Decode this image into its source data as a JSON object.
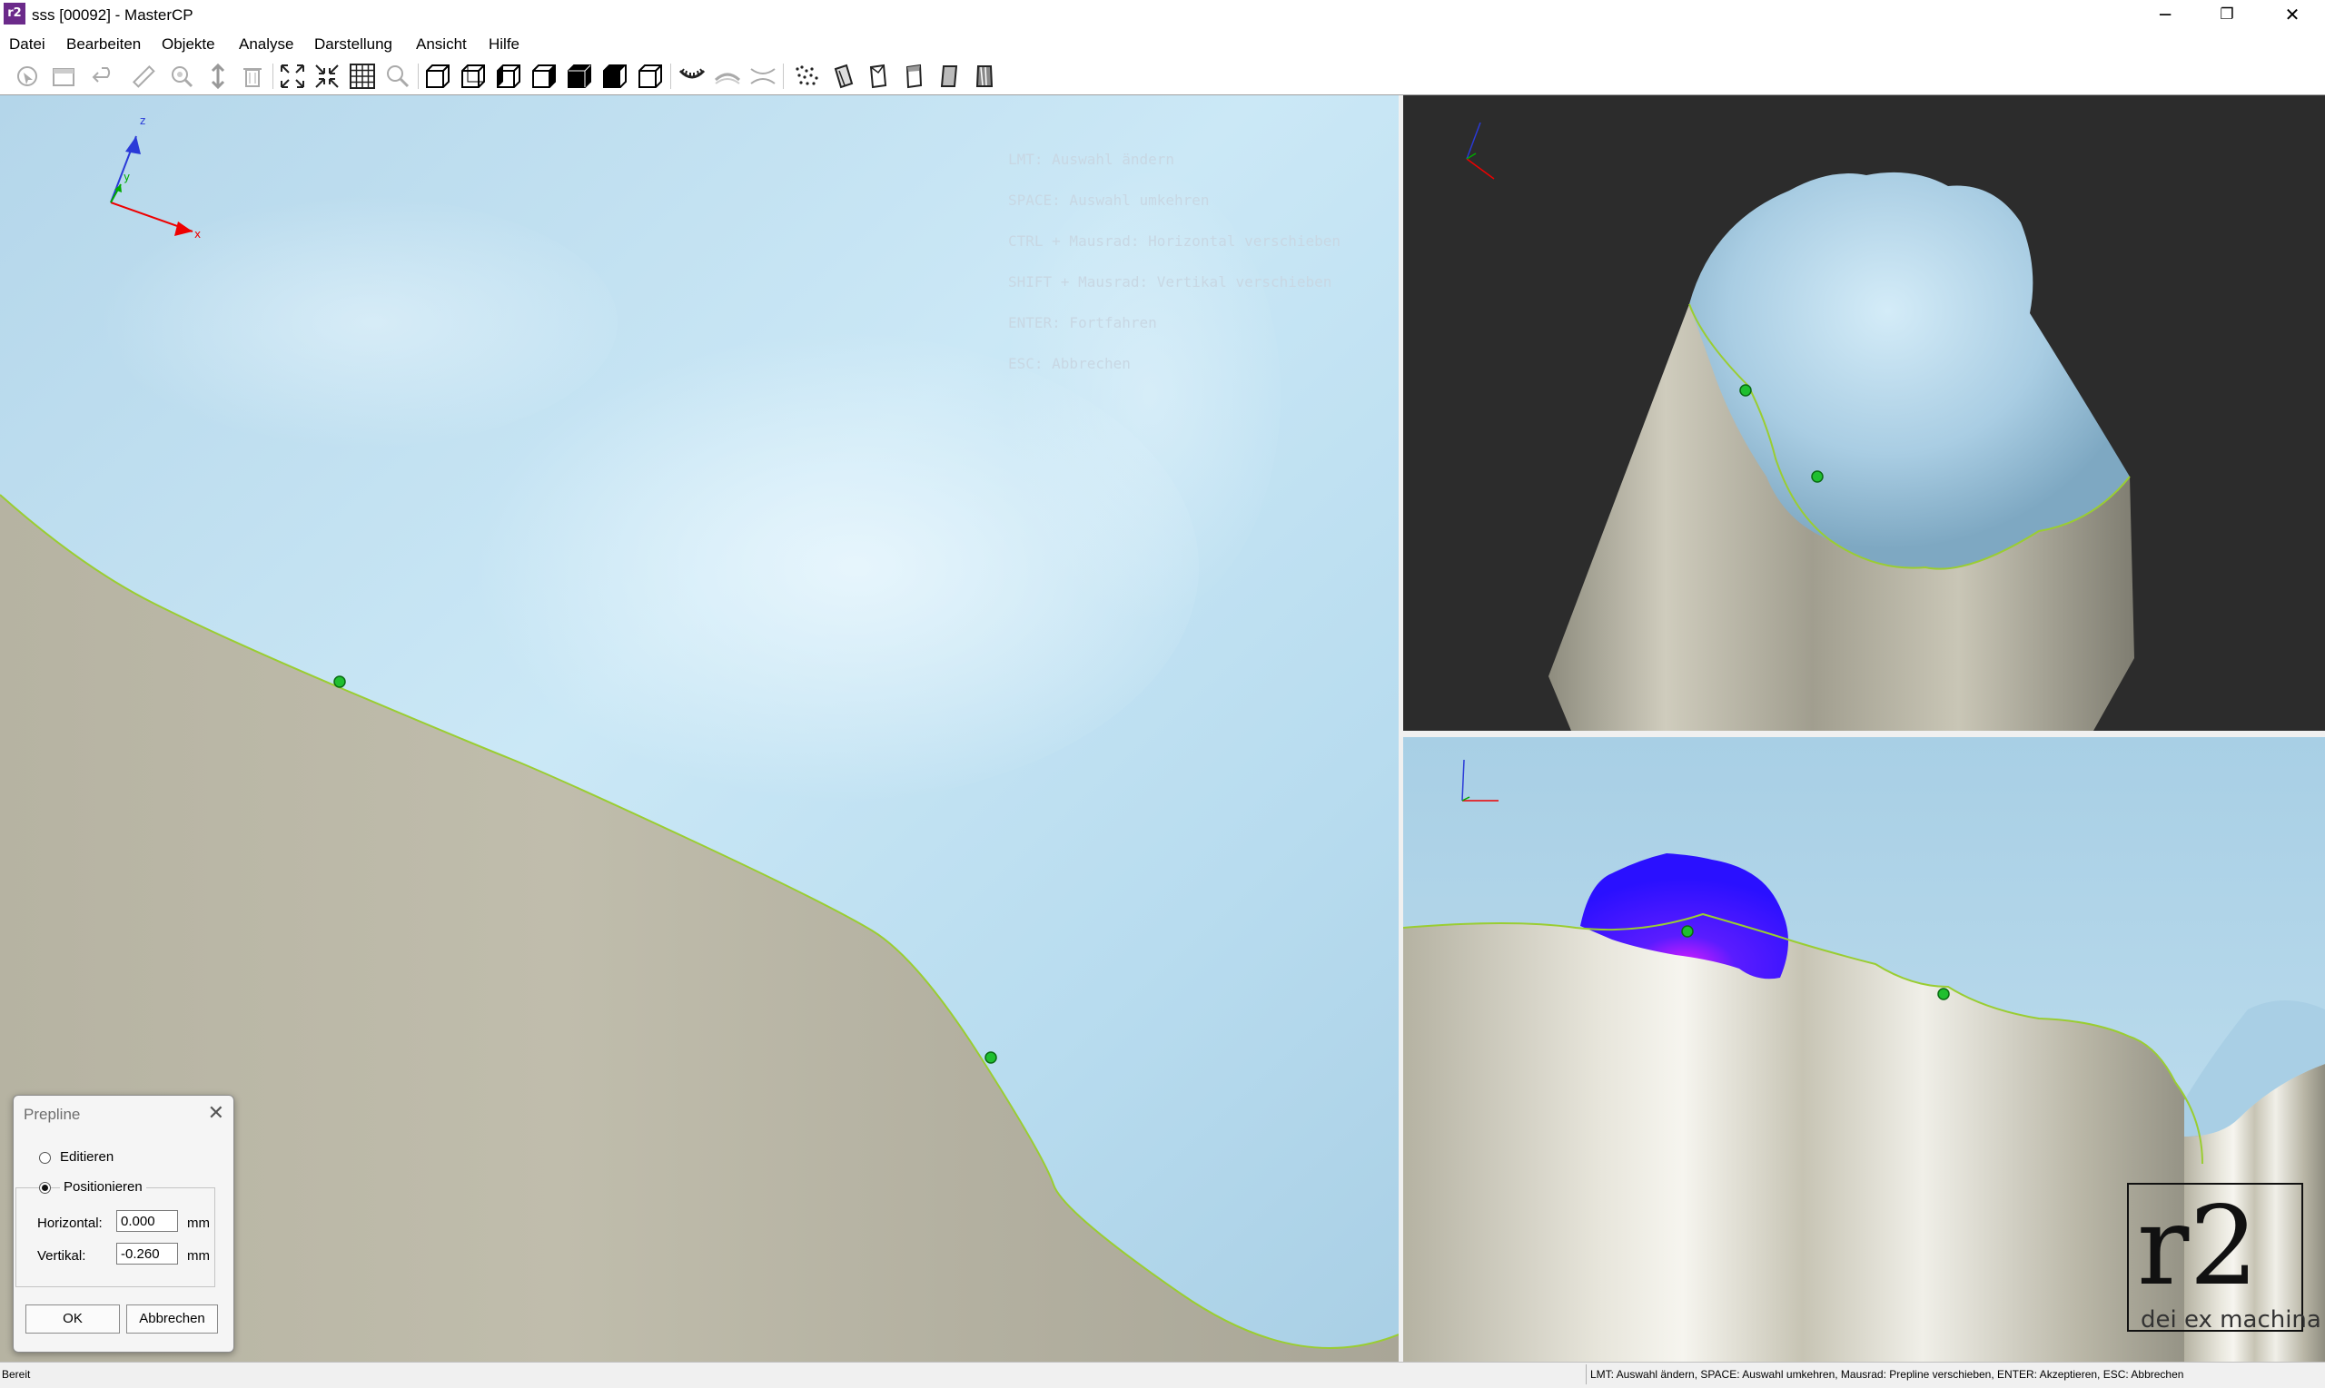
{
  "window": {
    "title": "sss [00092] - MasterCP",
    "app_icon_text": "r2",
    "minimize_glyph": "─",
    "restore_glyph": "❐",
    "close_glyph": "✕"
  },
  "menu": [
    "Datei",
    "Bearbeiten",
    "Objekte",
    "Analyse",
    "Darstellung",
    "Ansicht",
    "Hilfe"
  ],
  "toolbar_icons": [
    "cursor-icon",
    "box-icon",
    "undo-icon",
    "ruler-icon",
    "zoom-icon",
    "move-vertical-icon",
    "trash-icon",
    "expand-icon",
    "collapse-icon",
    "grid-icon",
    "magnifier-icon",
    "view-front-icon",
    "view-back-icon",
    "view-left-icon",
    "view-right-icon",
    "view-top-icon",
    "view-bottom-icon",
    "view-iso-icon",
    "jaw-upper-icon",
    "jaw-lower-icon",
    "jaw-both-icon",
    "points-icon",
    "die-1-icon",
    "die-2-icon",
    "die-3-icon",
    "die-4-icon",
    "die-5-icon"
  ],
  "viewport_main": {
    "hints": [
      "LMT: Auswahl ändern",
      "SPACE: Auswahl umkehren",
      "CTRL + Mausrad: Horizontal verschieben",
      "SHIFT + Mausrad: Vertikal verschieben",
      "ENTER: Fortfahren",
      "ESC: Abbrechen"
    ],
    "axis": {
      "x": "x",
      "y": "y",
      "z": "z"
    }
  },
  "logo": {
    "main": "r2",
    "sub": "dei ex machina"
  },
  "dialog": {
    "title": "Prepline",
    "close_glyph": "✕",
    "option_edit": "Editieren",
    "option_position": "Positionieren",
    "selected": "Positionieren",
    "horizontal_label": "Horizontal:",
    "horizontal_value": "0.000",
    "vertical_label": "Vertikal:",
    "vertical_value": "-0.260",
    "unit": "mm",
    "ok": "OK",
    "cancel": "Abbrechen"
  },
  "status": {
    "left": "Bereit",
    "right": "LMT: Auswahl ändern, SPACE: Auswahl umkehren, Mausrad: Prepline verschieben, ENTER: Akzeptieren, ESC: Abbrechen"
  },
  "colors": {
    "tooth": "#bfe0f2",
    "die": "#bab7a6",
    "background_dark": "#2c2c2c",
    "prepline": "#9acd32",
    "point": "#1fbf2f",
    "highlight": "#3a1cff"
  }
}
